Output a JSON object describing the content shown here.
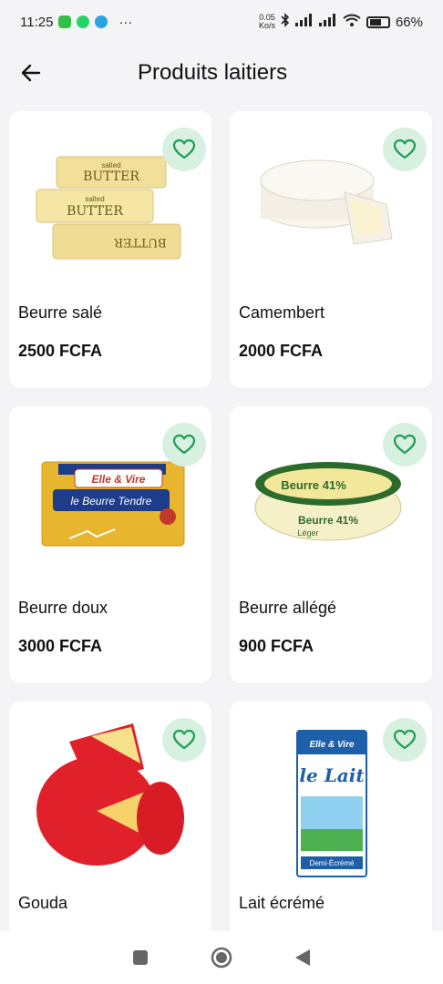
{
  "status_bar": {
    "time": "11:25",
    "more": "···",
    "network_speed_value": "0.05",
    "network_speed_unit": "Ko/s",
    "battery_percent": "66%"
  },
  "header": {
    "title": "Produits laitiers",
    "back_icon": "arrow-left-icon"
  },
  "products": [
    {
      "name": "Beurre salé",
      "price": "2500 FCFA",
      "image": "salted-butter-image"
    },
    {
      "name": "Camembert",
      "price": "2000 FCFA",
      "image": "camembert-image"
    },
    {
      "name": "Beurre doux",
      "price": "3000 FCFA",
      "image": "butter-pack-image"
    },
    {
      "name": "Beurre allégé",
      "price": "900 FCFA",
      "image": "light-butter-tub-image"
    },
    {
      "name": "Gouda",
      "price": "",
      "image": "gouda-image"
    },
    {
      "name": "Lait écrémé",
      "price": "",
      "image": "milk-carton-image"
    }
  ],
  "image_labels": {
    "butter_word": "BUTTER",
    "salted_word": "salted",
    "brand": "Elle & Vire",
    "beurre_tendre": "le Beurre Tendre",
    "beurre_41": "Beurre 41%",
    "leger": "Léger",
    "lait": "le Lait",
    "demi_ecreme": "Demi-Écrémé"
  },
  "colors": {
    "accent_green": "#1f9d55",
    "fav_bg": "#d7f0df",
    "background": "#f4f4f6"
  },
  "nav": {
    "recents_icon": "square-icon",
    "home_icon": "circle-home-icon",
    "back_icon": "triangle-back-icon"
  }
}
